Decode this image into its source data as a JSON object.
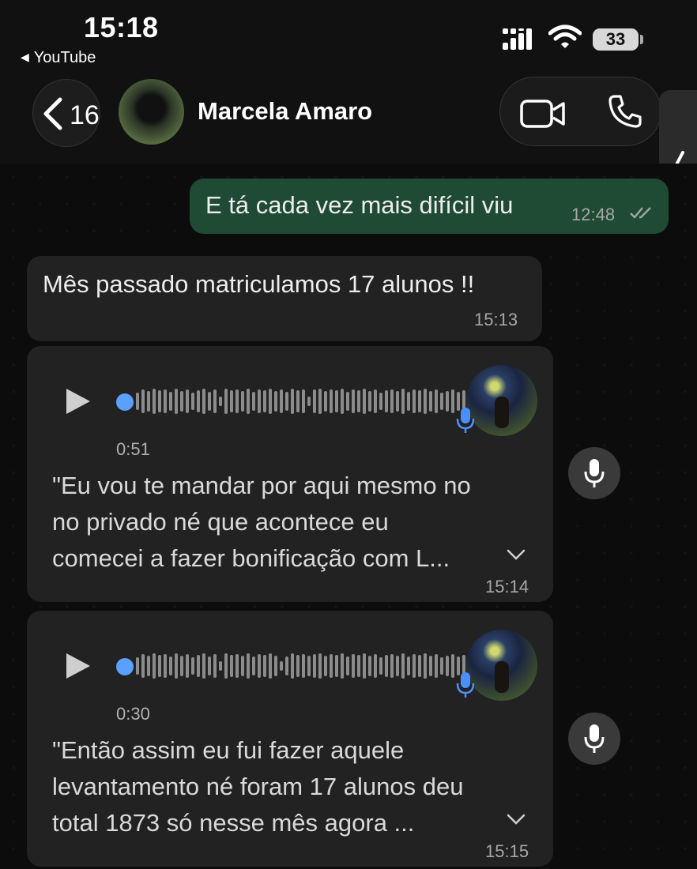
{
  "status_bar": {
    "time": "15:18",
    "back_app": "YouTube",
    "battery": "33"
  },
  "header": {
    "back_count": "16",
    "contact_name": "Marcela Amaro"
  },
  "messages": [
    {
      "type": "text",
      "direction": "outgoing",
      "text": "E tá cada vez mais difícil viu",
      "time": "12:48",
      "status": "read"
    },
    {
      "type": "text",
      "direction": "incoming",
      "text": "Mês passado matriculamos 17 alunos !!",
      "time": "15:13"
    },
    {
      "type": "voice",
      "direction": "incoming",
      "duration": "0:51",
      "transcript": [
        "\"Eu vou te mandar por aqui mesmo no",
        "no privado né que acontece eu",
        "comecei a fazer bonificação com L..."
      ],
      "time": "15:14"
    },
    {
      "type": "voice",
      "direction": "incoming",
      "duration": "0:30",
      "transcript": [
        "\"Então assim eu fui fazer aquele",
        "levantamento né foram 17 alunos deu",
        "total 1873 só nesse mês agora ..."
      ],
      "time": "15:15"
    }
  ],
  "colors": {
    "outgoing_bubble": "#1f4b35",
    "incoming_bubble": "#222223",
    "voice_dot": "#5aa0ff",
    "background": "#0c0c0c"
  },
  "icons": [
    "back-chevron-icon",
    "video-call-icon",
    "phone-call-icon",
    "play-icon",
    "microphone-icon",
    "chevron-down-icon",
    "read-ticks-icon"
  ]
}
